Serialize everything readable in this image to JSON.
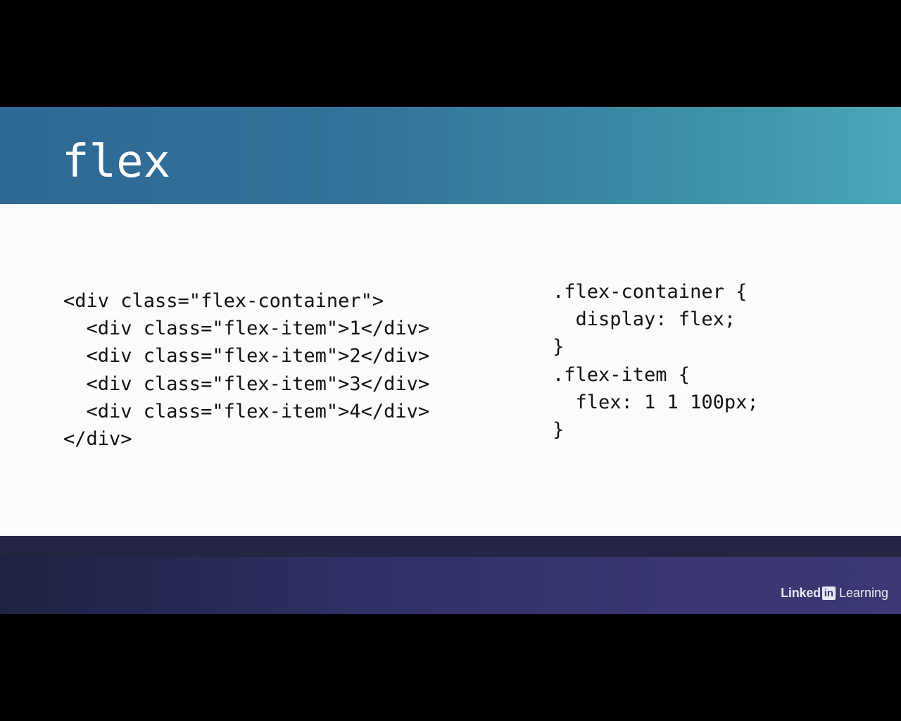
{
  "slide": {
    "title": "flex",
    "html_code": [
      "<div class=\"flex-container\">",
      "  <div class=\"flex-item\">1</div>",
      "  <div class=\"flex-item\">2</div>",
      "  <div class=\"flex-item\">3</div>",
      "  <div class=\"flex-item\">4</div>",
      "</div>"
    ],
    "css_code": [
      ".flex-container {",
      "  display: flex;",
      "}",
      ".flex-item {",
      "  flex: 1 1 100px;",
      "}"
    ]
  },
  "branding": {
    "linked": "Linked",
    "in": "in",
    "learning": "Learning"
  },
  "colors": {
    "title_bar_start": "#2e6894",
    "title_bar_end": "#4aa6b9",
    "content_background": "#fbfbfa",
    "footer_start": "#1f2345",
    "footer_end": "#3b3873",
    "letterbox": "#000000"
  }
}
